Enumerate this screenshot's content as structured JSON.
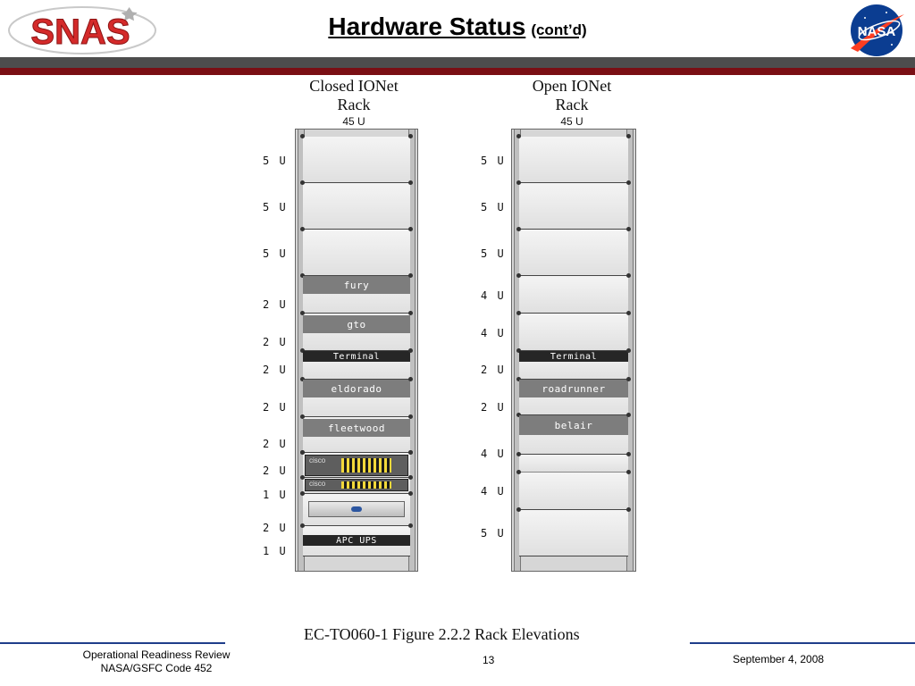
{
  "header": {
    "title": "Hardware Status",
    "subtitle": "(cont’d)",
    "left_logo_text": "SNAS",
    "right_logo_text": "NASA",
    "colors": {
      "grey_bar": "#4d4d4d",
      "red_bar": "#7a0f14",
      "snas_red": "#d42a2a"
    }
  },
  "figure": {
    "caption": "EC-TO060-1 Figure 2.2.2 Rack Elevations",
    "racks": [
      {
        "title_line1": "Closed IONet",
        "title_line2": "Rack",
        "size": "45 U",
        "slots": [
          {
            "u": "5 U"
          },
          {
            "u": "5 U"
          },
          {
            "u": "5 U"
          },
          {
            "u": "2 U",
            "label": "fury"
          },
          {
            "u": "2 U",
            "label": "gto"
          },
          {
            "u": "2 U",
            "label": "Terminal"
          },
          {
            "u": "2 U",
            "label": "eldorado"
          },
          {
            "u": "2 U",
            "label": "fleetwood"
          },
          {
            "u": "2 U"
          },
          {
            "u": "2 U",
            "label": "cisco"
          },
          {
            "u": "1 U",
            "label": "cisco"
          },
          {
            "u": "2 U"
          },
          {
            "u": "1 U",
            "label": "APC UPS"
          }
        ]
      },
      {
        "title_line1": "Open IONet",
        "title_line2": "Rack",
        "size": "45 U",
        "slots": [
          {
            "u": "5 U"
          },
          {
            "u": "5 U"
          },
          {
            "u": "5 U"
          },
          {
            "u": "4 U"
          },
          {
            "u": "4 U"
          },
          {
            "u": "2 U",
            "label": "Terminal"
          },
          {
            "u": "2 U",
            "label": "roadrunner"
          },
          {
            "u": "4 U",
            "label": "belair"
          },
          {
            "u": "4 U"
          },
          {
            "u": "5 U"
          }
        ]
      }
    ]
  },
  "footer": {
    "left_line1": "Operational Readiness Review",
    "left_line2": "NASA/GSFC Code 452",
    "page_number": "13",
    "date": "September 4, 2008"
  }
}
